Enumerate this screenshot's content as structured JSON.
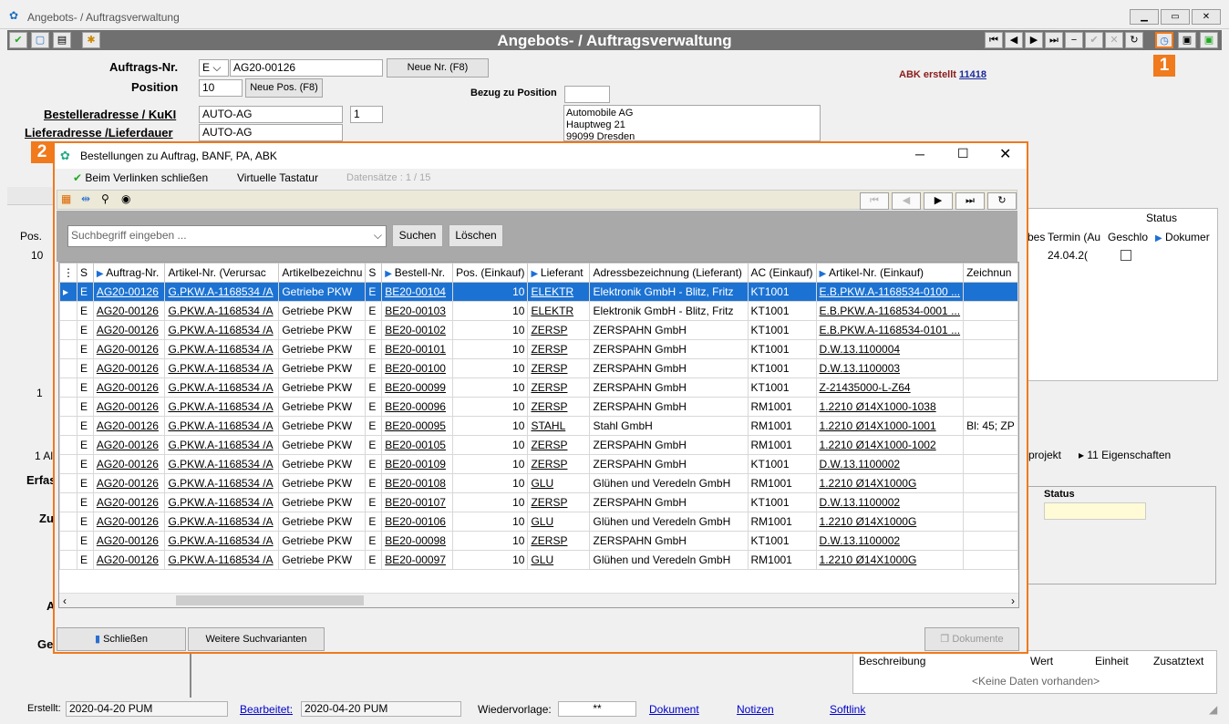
{
  "window": {
    "title": "Angebots- / Auftragsverwaltung"
  },
  "appbar": {
    "title": "Angebots- / Auftragsverwaltung"
  },
  "form": {
    "auftrags_label": "Auftrags-Nr.",
    "auftrags_prefix": "E",
    "auftrags_value": "AG20-00126",
    "neue_nr": "Neue Nr. (F8)",
    "position_label": "Position",
    "position_value": "10",
    "neue_pos": "Neue Pos. (F8)",
    "bezug_label": "Bezug zu Position",
    "abk_text": "ABK erstellt",
    "abk_link": "11418",
    "besteller_label": "Bestelleradresse / KuKI",
    "besteller_value": "AUTO-AG",
    "besteller_num": "1",
    "liefer_label": "Lieferadresse /Lieferdauer",
    "liefer_value": "AUTO-AG",
    "address": [
      "Automobile AG",
      "Hauptweg 21",
      "99099 Dresden"
    ]
  },
  "badges": {
    "one": "1",
    "two": "2"
  },
  "dialog": {
    "title": "Bestellungen zu Auftrag, BANF, PA, ABK",
    "close_on_link": "Beim Verlinken schließen",
    "virtual_keyboard": "Virtuelle Tastatur",
    "records": "Datensätze : 1 / 15",
    "search_placeholder": "Suchbegriff eingeben ...",
    "search_btn": "Suchen",
    "clear_btn": "Löschen",
    "close_btn": "Schließen",
    "more_search": "Weitere Suchvarianten",
    "docs_btn": "Dokumente",
    "columns": [
      "S",
      "Auftrag-Nr.",
      "Artikel-Nr. (Verursac",
      "Artikelbezeichnu",
      "S",
      "Bestell-Nr.",
      "Pos. (Einkauf)",
      "Lieferant",
      "Adressbezeichnung (Lieferant)",
      "AC (Einkauf)",
      "Artikel-Nr. (Einkauf)",
      "Zeichnun"
    ],
    "rows": [
      [
        "E",
        "AG20-00126",
        "G.PKW.A-1168534 /A",
        "Getriebe PKW",
        "E",
        "BE20-00104",
        "10",
        "ELEKTR",
        "Elektronik GmbH - Blitz, Fritz",
        "KT1001",
        "E.B.PKW.A-1168534-0100 ...",
        ""
      ],
      [
        "E",
        "AG20-00126",
        "G.PKW.A-1168534 /A",
        "Getriebe PKW",
        "E",
        "BE20-00103",
        "10",
        "ELEKTR",
        "Elektronik GmbH - Blitz, Fritz",
        "KT1001",
        "E.B.PKW.A-1168534-0001 ...",
        ""
      ],
      [
        "E",
        "AG20-00126",
        "G.PKW.A-1168534 /A",
        "Getriebe PKW",
        "E",
        "BE20-00102",
        "10",
        "ZERSP",
        "ZERSPAHN GmbH",
        "KT1001",
        "E.B.PKW.A-1168534-0101 ...",
        ""
      ],
      [
        "E",
        "AG20-00126",
        "G.PKW.A-1168534 /A",
        "Getriebe PKW",
        "E",
        "BE20-00101",
        "10",
        "ZERSP",
        "ZERSPAHN GmbH",
        "KT1001",
        "D.W.13.1100004",
        ""
      ],
      [
        "E",
        "AG20-00126",
        "G.PKW.A-1168534 /A",
        "Getriebe PKW",
        "E",
        "BE20-00100",
        "10",
        "ZERSP",
        "ZERSPAHN GmbH",
        "KT1001",
        "D.W.13.1100003",
        ""
      ],
      [
        "E",
        "AG20-00126",
        "G.PKW.A-1168534 /A",
        "Getriebe PKW",
        "E",
        "BE20-00099",
        "10",
        "ZERSP",
        "ZERSPAHN GmbH",
        "KT1001",
        "Z-21435000-L-Z64",
        ""
      ],
      [
        "E",
        "AG20-00126",
        "G.PKW.A-1168534 /A",
        "Getriebe PKW",
        "E",
        "BE20-00096",
        "10",
        "ZERSP",
        "ZERSPAHN GmbH",
        "RM1001",
        "1.2210 Ø14X1000-1038",
        ""
      ],
      [
        "E",
        "AG20-00126",
        "G.PKW.A-1168534 /A",
        "Getriebe PKW",
        "E",
        "BE20-00095",
        "10",
        "STAHL",
        "Stahl GmbH",
        "RM1001",
        "1.2210 Ø14X1000-1001",
        "Bl: 45; ZP"
      ],
      [
        "E",
        "AG20-00126",
        "G.PKW.A-1168534 /A",
        "Getriebe PKW",
        "E",
        "BE20-00105",
        "10",
        "ZERSP",
        "ZERSPAHN GmbH",
        "RM1001",
        "1.2210 Ø14X1000-1002",
        ""
      ],
      [
        "E",
        "AG20-00126",
        "G.PKW.A-1168534 /A",
        "Getriebe PKW",
        "E",
        "BE20-00109",
        "10",
        "ZERSP",
        "ZERSPAHN GmbH",
        "KT1001",
        "D.W.13.1100002",
        ""
      ],
      [
        "E",
        "AG20-00126",
        "G.PKW.A-1168534 /A",
        "Getriebe PKW",
        "E",
        "BE20-00108",
        "10",
        "GLU",
        "Glühen und Veredeln GmbH",
        "RM1001",
        "1.2210 Ø14X1000G",
        ""
      ],
      [
        "E",
        "AG20-00126",
        "G.PKW.A-1168534 /A",
        "Getriebe PKW",
        "E",
        "BE20-00107",
        "10",
        "ZERSP",
        "ZERSPAHN GmbH",
        "KT1001",
        "D.W.13.1100002",
        ""
      ],
      [
        "E",
        "AG20-00126",
        "G.PKW.A-1168534 /A",
        "Getriebe PKW",
        "E",
        "BE20-00106",
        "10",
        "GLU",
        "Glühen und Veredeln GmbH",
        "RM1001",
        "1.2210 Ø14X1000G",
        ""
      ],
      [
        "E",
        "AG20-00126",
        "G.PKW.A-1168534 /A",
        "Getriebe PKW",
        "E",
        "BE20-00098",
        "10",
        "ZERSP",
        "ZERSPAHN GmbH",
        "KT1001",
        "D.W.13.1100002",
        ""
      ],
      [
        "E",
        "AG20-00126",
        "G.PKW.A-1168534 /A",
        "Getriebe PKW",
        "E",
        "BE20-00097",
        "10",
        "GLU",
        "Glühen und Veredeln GmbH",
        "RM1001",
        "1.2210 Ø14X1000G",
        ""
      ]
    ]
  },
  "background": {
    "pos_header": "Pos.",
    "pos_value": "10",
    "status_header": "Status",
    "termin_header": "Termin (Au",
    "termin_value": "24.04.2(",
    "geschl_header": "Geschlo",
    "dokum_header": "Dokumer",
    "bes_header": "bes",
    "tabs": [
      "projekt",
      "11 Eigenschaften"
    ],
    "status_label": "Status",
    "props_cols": [
      "Beschreibung",
      "Wert",
      "Einheit",
      "Zusatztext"
    ],
    "no_data": "<Keine Daten vorhanden>",
    "left_labels": [
      "Erfas",
      "Zu",
      "A",
      "Ge"
    ],
    "page_num": "1",
    "tab_ok": "1 Al"
  },
  "statusbar": {
    "erstellt_label": "Erstellt:",
    "erstellt_value": "2020-04-20  PUM",
    "bearbeitet_label": "Bearbeitet:",
    "bearbeitet_value": "2020-04-20  PUM",
    "wiedervorlage_label": "Wiedervorlage:",
    "wiedervorlage_value": "**",
    "dokument": "Dokument",
    "notizen": "Notizen",
    "softlink": "Softlink"
  }
}
